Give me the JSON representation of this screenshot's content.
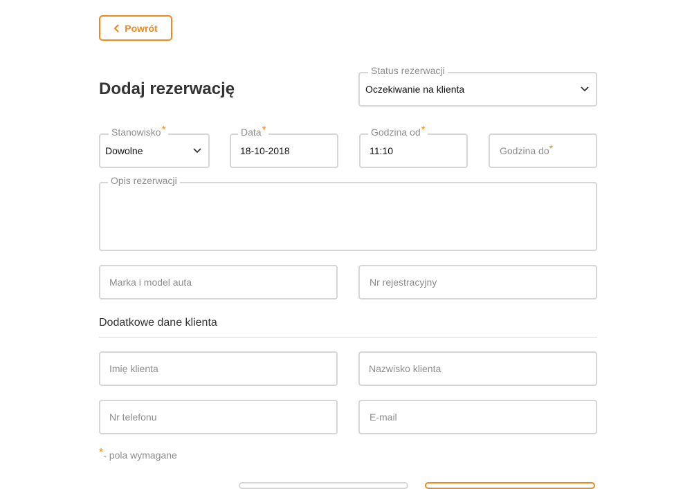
{
  "header": {
    "back_label": "Powrót",
    "page_title": "Dodaj rezerwację"
  },
  "status": {
    "label": "Status rezerwacji",
    "value": "Oczekiwanie na klienta"
  },
  "station": {
    "label": "Stanowisko",
    "value": "Dowolne"
  },
  "date": {
    "label": "Data",
    "value": "18-10-2018"
  },
  "time_from": {
    "label": "Godzina od",
    "value": "11:10"
  },
  "time_to": {
    "placeholder": "Godzina do"
  },
  "description": {
    "label": "Opis rezerwacji",
    "value": ""
  },
  "car": {
    "model_placeholder": "Marka i model auta",
    "plate_placeholder": "Nr rejestracyjny"
  },
  "client": {
    "section_title": "Dodatkowe dane klienta",
    "first_name_placeholder": "Imię klienta",
    "last_name_placeholder": "Nazwisko klienta",
    "phone_placeholder": "Nr telefonu",
    "email_placeholder": "E-mail"
  },
  "required": {
    "marker": "*",
    "note": "- pola wymagane"
  },
  "colors": {
    "accent": "#ee8a1c",
    "border": "#d6d6d6",
    "muted_text": "#8d8d8d"
  },
  "icons": {
    "back": "chevron-left-icon",
    "dropdown": "chevron-down-icon"
  }
}
